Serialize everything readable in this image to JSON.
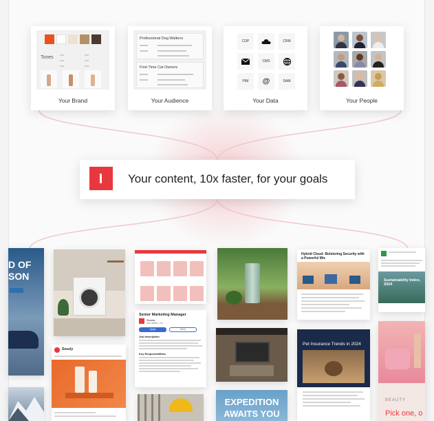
{
  "inputs": {
    "brand": {
      "caption": "Your Brand",
      "tones_label": "Tones",
      "swatches": [
        "#e8531d",
        "#ffffff",
        "#f0e2d0",
        "#b49068",
        "#4a3a30"
      ]
    },
    "audience": {
      "caption": "Your Audience",
      "segments": [
        "Professional Dog Walkers",
        "First-Time Cat Owners"
      ]
    },
    "data": {
      "caption": "Your Data",
      "cells": [
        "CDP",
        "CRM",
        "CMS",
        "PIM",
        "DAM"
      ]
    },
    "people": {
      "caption": "Your People"
    }
  },
  "banner": {
    "headline": "Your content, 10x faster, for your goals",
    "logo_color": "#e8383d"
  },
  "outputs": {
    "travel_ad": {
      "line1": "D OF",
      "line2": "SON"
    },
    "smart_home_report": {
      "title": "Hybrid Cloud: Bolstering Security with a Powerful Mix"
    },
    "sustainability": {
      "title": "Sustainability Index, 2024"
    },
    "job_post": {
      "title": "Senior Marketing Manager",
      "company": "Seusia",
      "location": "San Mateo, CA",
      "apply_label": "Apply",
      "save_label": "Save",
      "section": "Job description",
      "section2": "Key Responsibilities"
    },
    "social_post": {
      "account": "Seusly"
    },
    "pet_insurance": {
      "title": "Pet Insurance Trends in 2024"
    },
    "expedition": {
      "line1": "EXPEDITION",
      "line2": "AWAITS YOU"
    },
    "beauty": {
      "brand": "BEAUTY",
      "tagline": "Pick one, o"
    }
  }
}
